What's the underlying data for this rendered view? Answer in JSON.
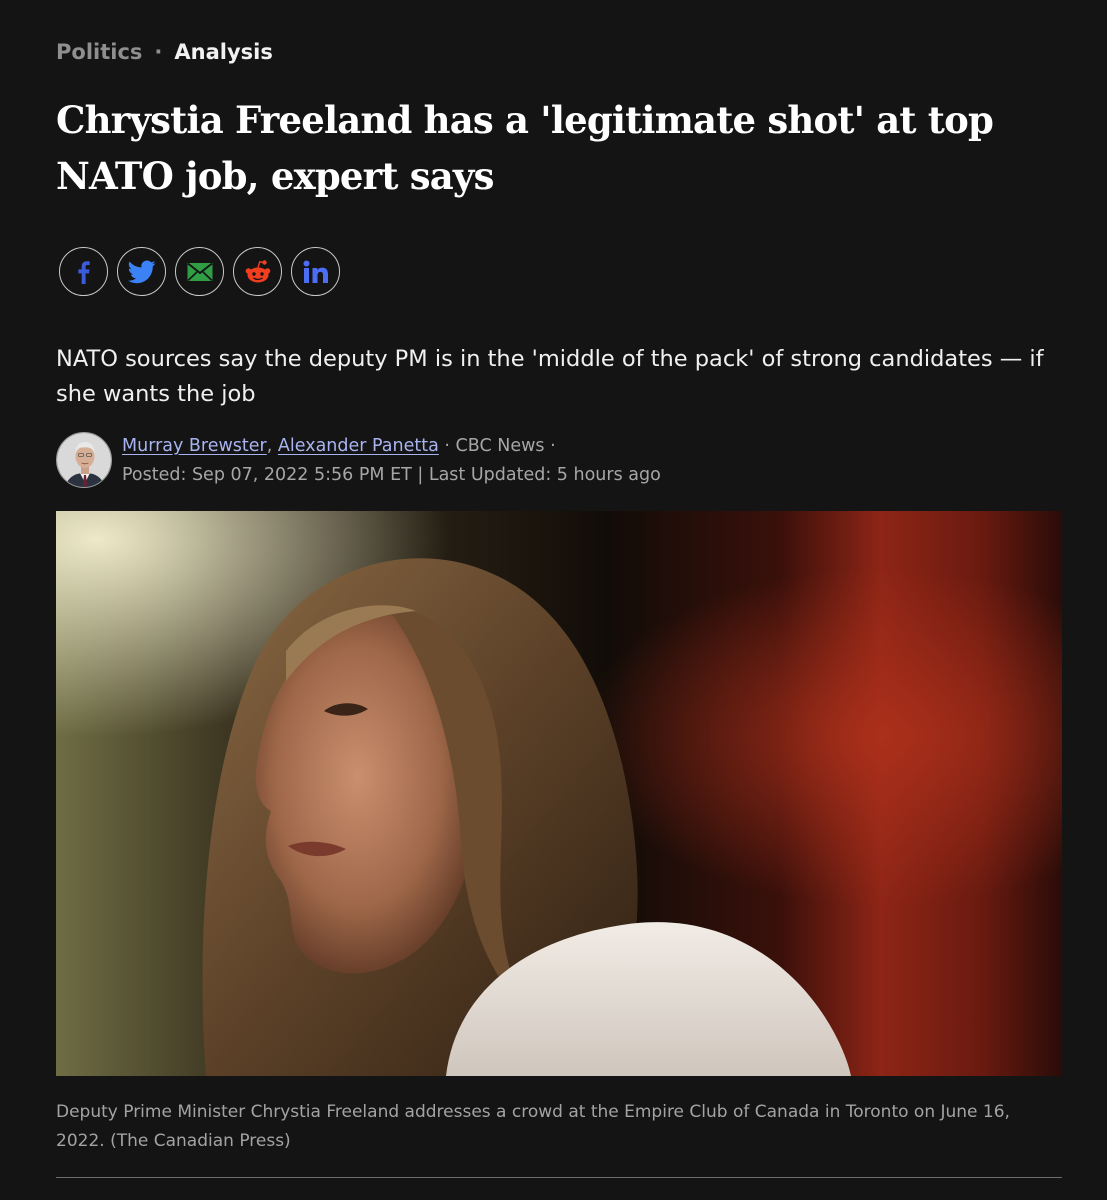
{
  "breadcrumb": {
    "section": "Politics",
    "separator": "·",
    "article_type": "Analysis"
  },
  "headline": "Chrystia Freeland has a 'legitimate shot' at top NATO job, expert says",
  "share": {
    "buttons": [
      {
        "icon": "facebook-icon",
        "color": "#3b5bdb"
      },
      {
        "icon": "twitter-icon",
        "color": "#3b82f6"
      },
      {
        "icon": "email-icon",
        "color": "#2f9e44"
      },
      {
        "icon": "reddit-icon",
        "color": "#f03e1e"
      },
      {
        "icon": "linkedin-icon",
        "color": "#4c6ef5"
      }
    ]
  },
  "deck": "NATO sources say the deputy PM is in the 'middle of the pack' of strong candidates — if she wants the job",
  "byline": {
    "authors": [
      "Murray Brewster",
      "Alexander Panetta"
    ],
    "author_separator": ",",
    "publisher": "· CBC News ·",
    "dates": "Posted: Sep 07, 2022 5:56 PM ET | Last Updated: 5 hours ago"
  },
  "hero": {
    "caption": "Deputy Prime Minister Chrystia Freeland addresses a crowd at the Empire Club of Canada in Toronto on June 16, 2022. (The Canadian Press)"
  },
  "colors": {
    "background": "#141414",
    "author_link": "#a8b4f0",
    "muted_text": "#a6a6a6"
  }
}
